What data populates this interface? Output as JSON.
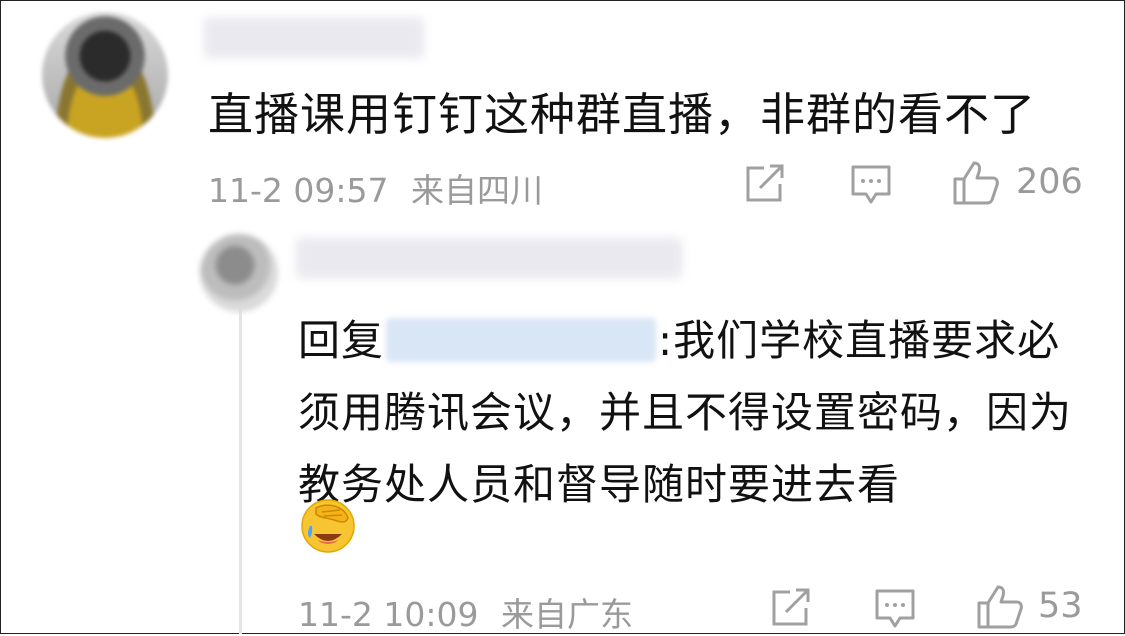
{
  "comment": {
    "text": "直播课用钉钉这种群直播，非群的看不了",
    "time": "11-2 09:57",
    "location": "来自四川",
    "likes": "206",
    "icons": [
      "share-icon",
      "comment-icon",
      "like-icon"
    ]
  },
  "reply": {
    "prefix": "回复",
    "text": ":我们学校直播要求必须用腾讯会议，并且不得设置密码，因为教务处人员和督导随时要进去看",
    "emoji": "facepalm-laugh-emoji",
    "time": "11-2 10:09",
    "location": "来自广东",
    "likes": "53",
    "icons": [
      "share-icon",
      "comment-icon",
      "like-icon"
    ]
  }
}
